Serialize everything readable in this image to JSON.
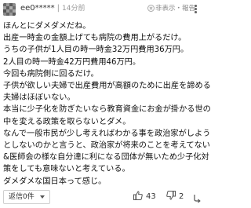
{
  "comment": {
    "username": "ee0*****",
    "separator": "|",
    "timestamp": "14分前",
    "hide_label": "非表示・報告",
    "lines": [
      "ほんとにダメダメだね。",
      "出産一時金の金額上げても病院の費用上がるだけ。",
      "うちの子供が1人目の時一時金32万円費用36万円。",
      "2人目の時一時金42万円費用46万円。",
      "今回も病院側に回るだけ。",
      "子供が欲しい夫婦で出産費用が高額のために出産を諦める",
      "夫婦はほぼいない。",
      "本当に少子化を防ぎたいなら教育資金にお金が掛かる世の",
      "中を変える政策を取らないとダメ。",
      "なんで一般市民が少し考えればわかる事を政治家がしよう",
      "としないのかと言うと、政治家が将来のことを考えてない",
      "&医師会の様な自分達に利になる団体が無いため少子化対",
      "策をしても意味ないと考えている。",
      "ダメダメな国日本って感じ。"
    ]
  },
  "footer": {
    "reply_label": "返信0件",
    "likes": "43",
    "dislikes": "2"
  },
  "icons": {
    "hide": "close-circle-icon",
    "more": "more-vertical-icon",
    "like": "thumbs-up-icon",
    "dislike": "thumbs-down-icon",
    "reply": "reply-icon"
  },
  "colors": {
    "text": "#111111",
    "meta": "#999999",
    "avatar": "#7f7f7f"
  }
}
